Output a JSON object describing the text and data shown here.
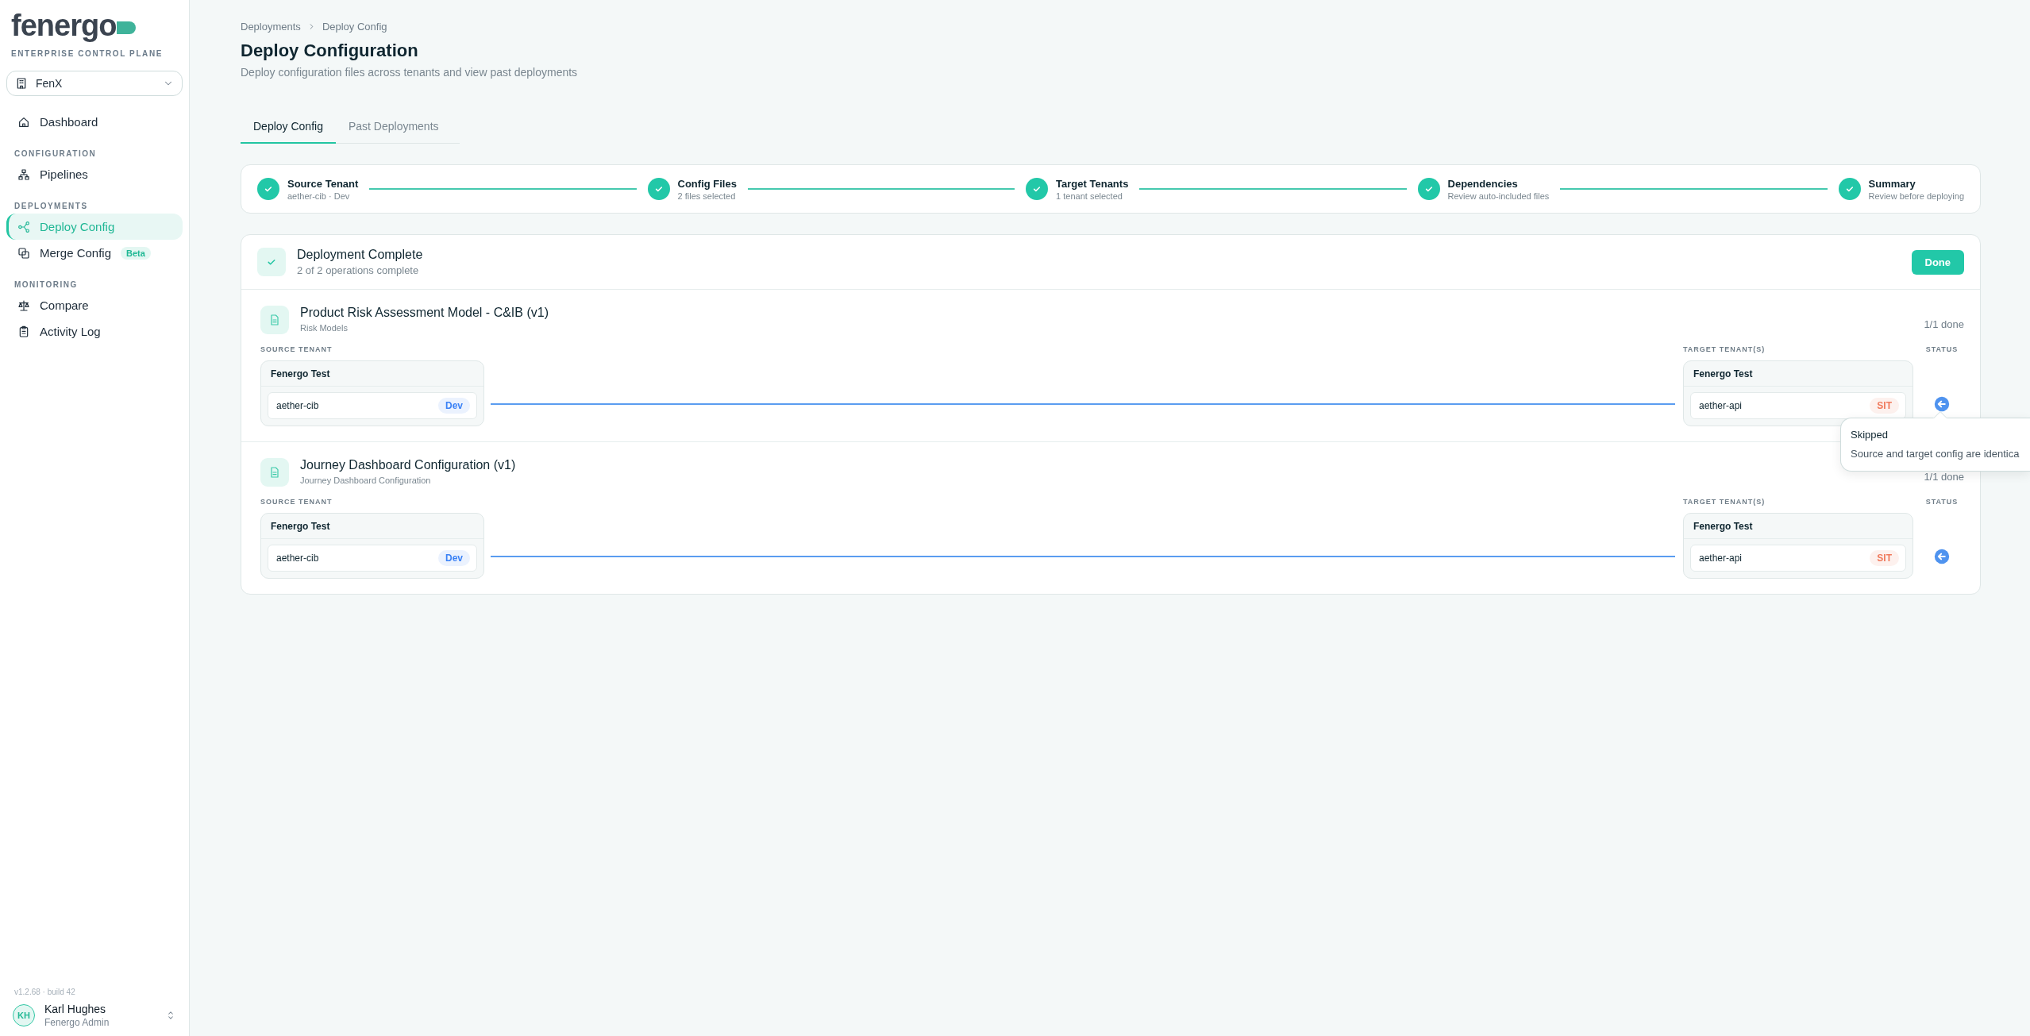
{
  "brand": {
    "logo": "fenergo",
    "subtitle": "ENTERPRISE CONTROL PLANE"
  },
  "workspace_selector": {
    "value": "FenX"
  },
  "sidebar": {
    "sections": [
      {
        "items": [
          {
            "label": "Dashboard",
            "selected": false
          }
        ]
      },
      {
        "heading": "CONFIGURATION",
        "items": [
          {
            "label": "Pipelines",
            "selected": false
          }
        ]
      },
      {
        "heading": "DEPLOYMENTS",
        "items": [
          {
            "label": "Deploy Config",
            "selected": true
          },
          {
            "label": "Merge Config",
            "selected": false,
            "badge": "Beta"
          }
        ]
      },
      {
        "heading": "MONITORING",
        "items": [
          {
            "label": "Compare",
            "selected": false
          },
          {
            "label": "Activity Log",
            "selected": false
          }
        ]
      }
    ]
  },
  "version": "v1.2.68 · build 42",
  "user": {
    "initials": "KH",
    "name": "Karl Hughes",
    "role": "Fenergo Admin"
  },
  "breadcrumb": [
    "Deployments",
    "Deploy Config"
  ],
  "title": "Deploy Configuration",
  "subtitle": "Deploy configuration files across tenants and view past deployments",
  "tabs": [
    {
      "label": "Deploy Config",
      "selected": true
    },
    {
      "label": "Past Deployments",
      "selected": false
    }
  ],
  "steps": [
    {
      "title": "Source Tenant",
      "subtitle": "aether-cib · Dev",
      "completed": true
    },
    {
      "title": "Config Files",
      "subtitle": "2 files selected",
      "completed": true
    },
    {
      "title": "Target Tenants",
      "subtitle": "1 tenant selected",
      "completed": true
    },
    {
      "title": "Dependencies",
      "subtitle": "Review auto-included files",
      "completed": true
    },
    {
      "title": "Summary",
      "subtitle": "Review before deploying",
      "completed": true
    }
  ],
  "deployment": {
    "title": "Deployment Complete",
    "subtitle": "2 of 2 operations complete",
    "button": "Done",
    "operations": [
      {
        "title": "Product Risk Assessment Model - C&IB (v1)",
        "category": "Risk Models",
        "progress": "1/1 done",
        "source_label": "SOURCE TENANT",
        "target_label": "TARGET TENANT(S)",
        "status_label": "STATUS",
        "skipped": true,
        "source": {
          "group": "Fenergo Test",
          "tenant": "aether-cib",
          "env": "Dev",
          "color": "#3b82f6"
        },
        "target": {
          "group": "Fenergo Test",
          "tenant": "aether-api",
          "env": "SIT",
          "color": "#f07a5c"
        }
      },
      {
        "title": "Journey Dashboard Configuration (v1)",
        "category": "Journey Dashboard Configuration",
        "progress": "1/1 done",
        "source_label": "SOURCE TENANT",
        "target_label": "TARGET TENANT(S)",
        "status_label": "STATUS",
        "skipped": true,
        "source": {
          "group": "Fenergo Test",
          "tenant": "aether-cib",
          "env": "Dev",
          "color": "#3b82f6"
        },
        "target": {
          "group": "Fenergo Test",
          "tenant": "aether-api",
          "env": "SIT",
          "color": "#f07a5c"
        }
      }
    ]
  },
  "tooltip": {
    "title": "Skipped",
    "text": "Source and target config are identica"
  }
}
